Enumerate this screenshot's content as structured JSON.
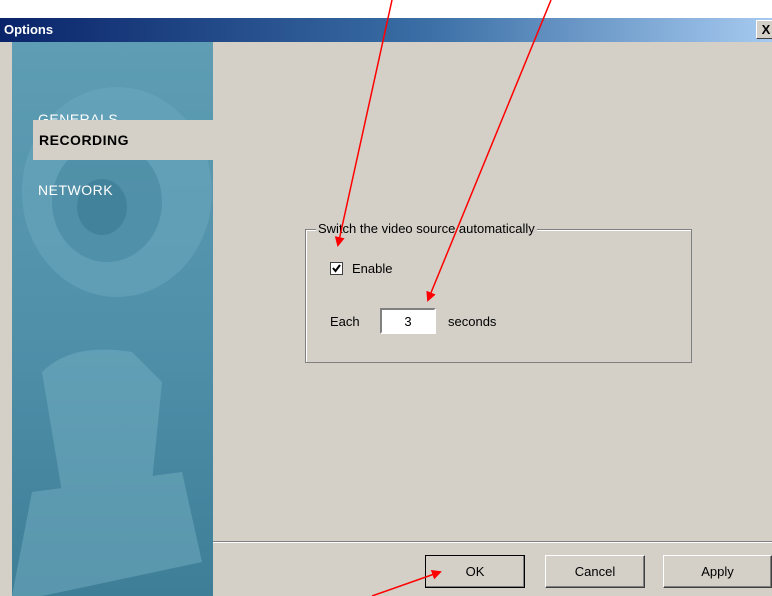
{
  "window": {
    "title": "Options",
    "close_glyph": "X"
  },
  "sidebar": {
    "items": [
      {
        "label": "GENERALS",
        "active": false
      },
      {
        "label": "RECORDING",
        "active": true
      },
      {
        "label": "NETWORK",
        "active": false
      }
    ],
    "background_color": "#5e9db3"
  },
  "group": {
    "legend": "Switch the video source automatically",
    "enable_label": "Enable",
    "enable_checked": true,
    "each_label": "Each",
    "seconds_value": "3",
    "seconds_label": "seconds"
  },
  "buttons": {
    "ok": "OK",
    "cancel": "Cancel",
    "apply": "Apply"
  },
  "annotations": {
    "arrow_color": "#ff0000",
    "arrow_count": 4
  }
}
